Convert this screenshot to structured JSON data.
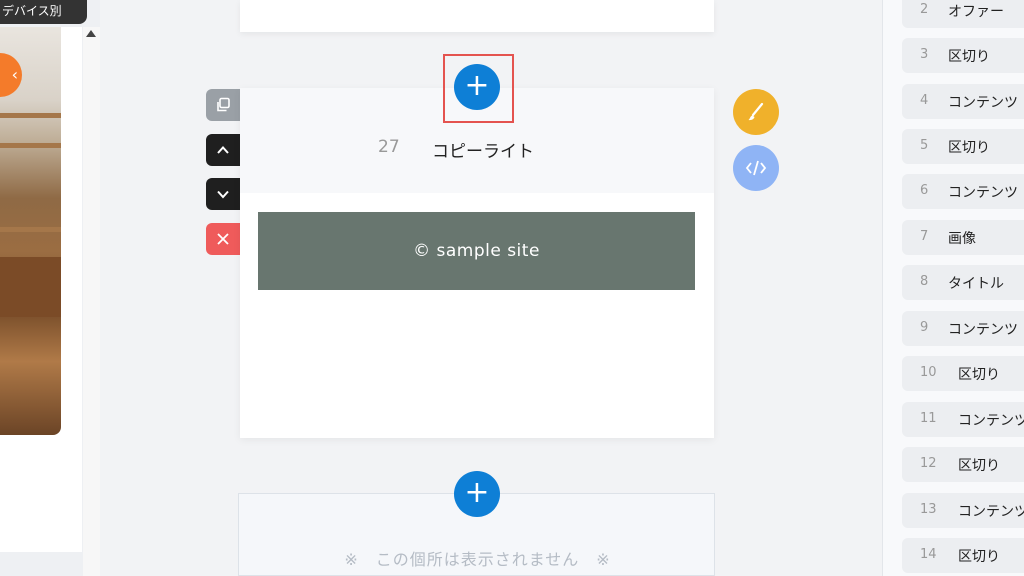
{
  "preview": {
    "device_tab_label": "デバイス別"
  },
  "editor": {
    "add_button_symbol": "+",
    "block": {
      "number": "27",
      "title": "コピーライト",
      "footer_text": "© sample site"
    },
    "hidden_notice": "※　この個所は表示されません　※"
  },
  "colors": {
    "add_button": "#0e7fd6",
    "highlight": "#e4534f",
    "footer_bar": "#68766f",
    "brush_button": "#f0b12b",
    "code_button": "#8fb4f5",
    "delete_button": "#ef5b5b"
  },
  "icons": {
    "copy": "copy-icon",
    "up": "chevron-up-icon",
    "down": "chevron-down-icon",
    "delete": "close-icon",
    "brush": "brush-icon",
    "code": "code-icon"
  },
  "block_list": [
    {
      "num": "2",
      "label": "オファー"
    },
    {
      "num": "3",
      "label": "区切り"
    },
    {
      "num": "4",
      "label": "コンテンツ"
    },
    {
      "num": "5",
      "label": "区切り"
    },
    {
      "num": "6",
      "label": "コンテンツ"
    },
    {
      "num": "7",
      "label": "画像"
    },
    {
      "num": "8",
      "label": "タイトル"
    },
    {
      "num": "9",
      "label": "コンテンツ"
    },
    {
      "num": "10",
      "label": "区切り"
    },
    {
      "num": "11",
      "label": "コンテンツ"
    },
    {
      "num": "12",
      "label": "区切り"
    },
    {
      "num": "13",
      "label": "コンテンツ"
    },
    {
      "num": "14",
      "label": "区切り"
    }
  ]
}
